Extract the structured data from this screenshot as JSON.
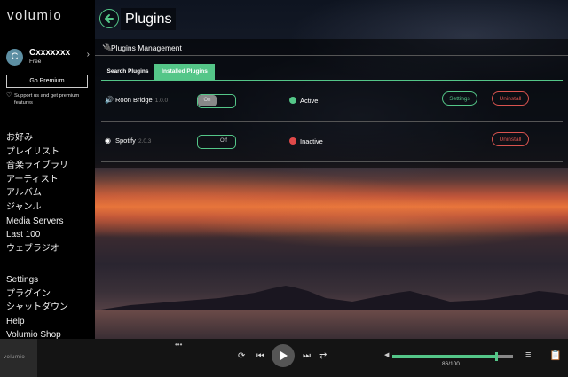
{
  "brand": {
    "logo": "volumio",
    "accent": "#54c688",
    "danger": "#d9534f"
  },
  "user": {
    "initial": "C",
    "name": "Cxxxxxxx",
    "plan": "Free"
  },
  "premium": {
    "button_label": "Go Premium",
    "support_text": "Support us and get premium features"
  },
  "nav": {
    "items": [
      "お好み",
      "プレイリスト",
      "音楽ライブラリ",
      "アーティスト",
      "アルバム",
      "ジャンル",
      "Media Servers",
      "Last 100",
      "ウェブラジオ"
    ],
    "bottom_items": [
      "Settings",
      "プラグイン",
      "シャットダウン",
      "Help",
      "Volumio Shop"
    ]
  },
  "header": {
    "title": "Plugins",
    "back_icon": "arrow-left-icon"
  },
  "panel": {
    "title": "Plugins Management",
    "tabs": [
      {
        "label": "Search Plugins",
        "active": false
      },
      {
        "label": "Installed Plugins",
        "active": true
      }
    ],
    "plugins": [
      {
        "name": "Roon Bridge",
        "version": "1.0.0",
        "icon": "speaker-icon",
        "toggle": "On",
        "status": "Active",
        "status_color": "#54c688",
        "settings_label": "Settings",
        "uninstall_label": "Uninstall"
      },
      {
        "name": "Spotify",
        "version": "2.0.3",
        "icon": "spotify-icon",
        "toggle": "Off",
        "status": "Inactive",
        "status_color": "#e04949",
        "uninstall_label": "Uninstall"
      }
    ]
  },
  "player": {
    "thumb_logo": "volumio",
    "volume_text": "86/100",
    "volume_value": 86
  }
}
